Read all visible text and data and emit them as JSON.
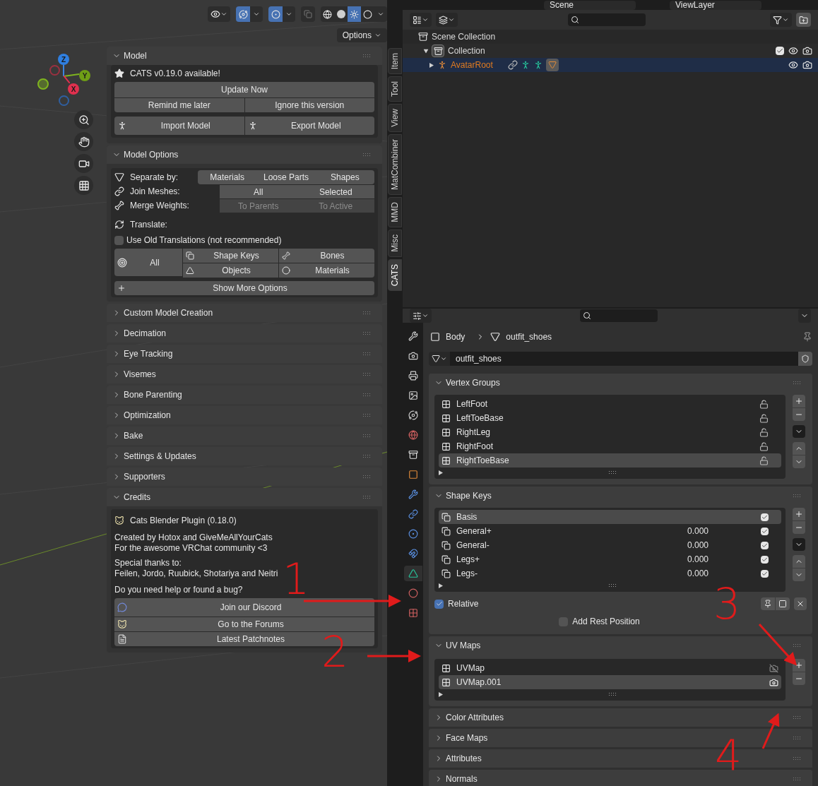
{
  "outliner_top": {
    "scene": "Scene",
    "view_layer": "ViewLayer"
  },
  "viewport": {
    "options_label": "Options",
    "axes": [
      {
        "label": "Z"
      },
      {
        "label": "Y"
      },
      {
        "label": "X"
      }
    ]
  },
  "model_panel": {
    "title": "Model",
    "expanded": true,
    "notice": "CATS v0.19.0 available!",
    "update_button": "Update Now",
    "remind_button": "Remind me later",
    "ignore_button": "Ignore this version",
    "import_button": "Import Model",
    "export_button": "Export Model"
  },
  "model_options": {
    "title": "Model Options",
    "expanded": true,
    "separate_label": "Separate by:",
    "separate_buttons": [
      "Materials",
      "Loose Parts",
      "Shapes"
    ],
    "join_label": "Join Meshes:",
    "join_buttons": [
      {
        "label": "All",
        "disabled": false
      },
      {
        "label": "Selected",
        "disabled": false
      }
    ],
    "merge_label": "Merge Weights:",
    "merge_buttons": [
      {
        "label": "To Parents",
        "disabled": true
      },
      {
        "label": "To Active",
        "disabled": true
      }
    ],
    "translate_label": "Translate:",
    "old_translations": {
      "label": "Use Old Translations (not recommended)",
      "checked": false
    },
    "translate_all": "All",
    "translate_buttons": [
      {
        "label": "Shape Keys",
        "kind": "shapekey"
      },
      {
        "label": "Bones",
        "kind": "bone"
      },
      {
        "label": "Objects",
        "kind": "mesh"
      },
      {
        "label": "Materials",
        "kind": "material"
      }
    ],
    "more_button": "Show More Options"
  },
  "collapsed_panels": [
    {
      "title": "Custom Model Creation",
      "expanded": false
    },
    {
      "title": "Decimation",
      "expanded": false
    },
    {
      "title": "Eye Tracking",
      "expanded": false
    },
    {
      "title": "Visemes",
      "expanded": false
    },
    {
      "title": "Bone Parenting",
      "expanded": false
    },
    {
      "title": "Optimization",
      "expanded": false
    },
    {
      "title": "Bake",
      "expanded": false
    },
    {
      "title": "Settings & Updates",
      "expanded": false
    },
    {
      "title": "Supporters",
      "expanded": false
    }
  ],
  "credits": {
    "title": "Credits",
    "expanded": true,
    "plugin": "Cats Blender Plugin (0.18.0)",
    "lines": [
      "Created by Hotox and GiveMeAllYourCats",
      "For the awesome VRChat community <3"
    ],
    "thanks": [
      "Special thanks to:",
      "Feilen, Jordo, Ruubick, Shotariya and Neitri"
    ],
    "question": "Do you need help or found a bug?",
    "buttons": [
      {
        "label": "Join our Discord",
        "kind": "discord"
      },
      {
        "label": "Go to the Forums",
        "kind": "cat"
      },
      {
        "label": "Latest Patchnotes",
        "kind": "text"
      }
    ]
  },
  "sidebar_tabs": [
    {
      "label": "Item",
      "selected": false
    },
    {
      "label": "Tool",
      "selected": false
    },
    {
      "label": "View",
      "selected": false
    },
    {
      "label": "MatCombiner",
      "selected": false
    },
    {
      "label": "MMD",
      "selected": false
    },
    {
      "label": "Misc",
      "selected": false
    },
    {
      "label": "CATS",
      "selected": true
    }
  ],
  "outliner": {
    "tree": [
      {
        "label": "Scene Collection",
        "kind": "scene",
        "children": [
          {
            "label": "Collection",
            "kind": "collection",
            "expanded": true,
            "checked": true,
            "children": [
              {
                "label": "AvatarRoot",
                "kind": "object",
                "expanded": false,
                "selected": true
              }
            ]
          }
        ]
      }
    ]
  },
  "properties": {
    "breadcrumb": [
      "Body",
      "outfit_shoes"
    ],
    "data_name": "outfit_shoes",
    "tabs": [
      {
        "kind": "tool",
        "selected": false
      },
      {
        "kind": "render",
        "selected": false
      },
      {
        "kind": "output",
        "selected": false
      },
      {
        "kind": "view_layer",
        "selected": false
      },
      {
        "kind": "scene",
        "selected": false
      },
      {
        "kind": "world",
        "selected": false
      },
      {
        "kind": "collection",
        "selected": false
      },
      {
        "kind": "object",
        "selected": false
      },
      {
        "kind": "modifiers",
        "selected": false
      },
      {
        "kind": "particles",
        "selected": false
      },
      {
        "kind": "physics",
        "selected": false
      },
      {
        "kind": "constraints",
        "selected": false
      },
      {
        "kind": "data",
        "selected": true
      },
      {
        "kind": "material",
        "selected": false
      },
      {
        "kind": "texture",
        "selected": false
      }
    ],
    "vertex_groups": {
      "title": "Vertex Groups",
      "expanded": true,
      "items": [
        {
          "name": "LeftFoot",
          "selected": false
        },
        {
          "name": "LeftToeBase",
          "selected": false
        },
        {
          "name": "RightLeg",
          "selected": false
        },
        {
          "name": "RightFoot",
          "selected": false
        },
        {
          "name": "RightToeBase",
          "selected": true
        }
      ]
    },
    "shape_keys": {
      "title": "Shape Keys",
      "expanded": true,
      "items": [
        {
          "name": "Basis",
          "selected": true,
          "checked": true
        },
        {
          "name": "General+",
          "value": "0.000",
          "selected": false,
          "checked": true
        },
        {
          "name": "General-",
          "value": "0.000",
          "selected": false,
          "checked": true
        },
        {
          "name": "Legs+",
          "value": "0.000",
          "selected": false,
          "checked": true
        },
        {
          "name": "Legs-",
          "value": "0.000",
          "selected": false,
          "checked": true
        }
      ],
      "relative": {
        "label": "Relative",
        "checked": true
      },
      "rest_position": {
        "label": "Add Rest Position",
        "checked": false
      }
    },
    "uv_maps": {
      "title": "UV Maps",
      "expanded": true,
      "items": [
        {
          "name": "UVMap",
          "selected": false,
          "active_render": false
        },
        {
          "name": "UVMap.001",
          "selected": true,
          "active_render": true
        }
      ]
    },
    "collapsed_panels": [
      {
        "title": "Color Attributes",
        "expanded": false
      },
      {
        "title": "Face Maps",
        "expanded": false
      },
      {
        "title": "Attributes",
        "expanded": false
      },
      {
        "title": "Normals",
        "expanded": false
      }
    ]
  },
  "annotations": [
    {
      "text": "1"
    },
    {
      "text": "2"
    },
    {
      "text": "3"
    },
    {
      "text": "4"
    }
  ]
}
